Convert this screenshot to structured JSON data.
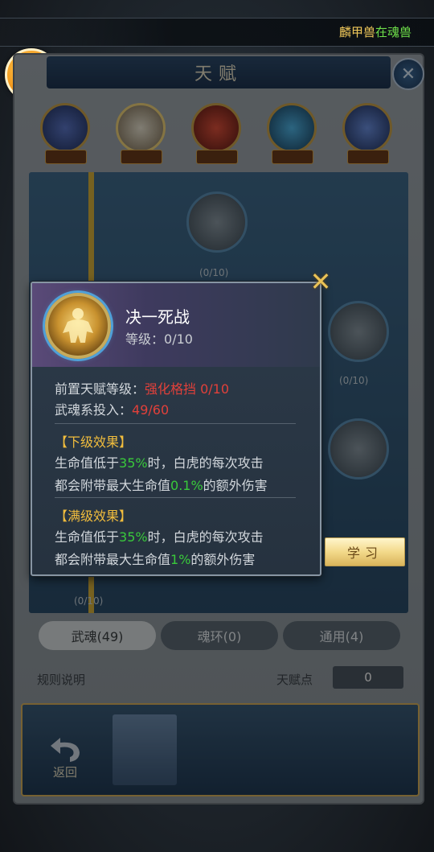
{
  "top_notice": {
    "name": "麟甲兽",
    "message": "在魂兽"
  },
  "panel": {
    "title": "天赋",
    "souls": [
      {
        "tag": "",
        "level": ""
      },
      {
        "tag": "",
        "level": ""
      },
      {
        "tag": "",
        "level": ""
      },
      {
        "tag": "",
        "level": ""
      },
      {
        "tag": "",
        "level": ""
      }
    ],
    "nodes": [
      {
        "label": "",
        "progress": "(0/10)"
      },
      {
        "label": "",
        "progress": "(0/10)"
      },
      {
        "label": "",
        "progress": "(0/10)"
      }
    ],
    "tabs": [
      {
        "label": "武魂(49)"
      },
      {
        "label": "魂环(0)"
      },
      {
        "label": "通用(4)"
      }
    ],
    "rules_label": "规则说明",
    "points_label": "天赋点",
    "points_value": "0",
    "back_label": "返回"
  },
  "tooltip": {
    "skill_name": "决一死战",
    "level_label": "等级：",
    "level_value": "0/10",
    "prereq_label": "前置天赋等级：",
    "prereq_value": "强化格挡 0/10",
    "invest_label": "武魂系投入：",
    "invest_value": "49/60",
    "next_effect_title": "【下级效果】",
    "next_line1": [
      "生命值低于",
      "35%",
      "时，白虎的每次攻击"
    ],
    "next_line2": [
      "都会附带最大生命值",
      "0.1%",
      "的额外伤害"
    ],
    "max_effect_title": "【满级效果】",
    "max_line1": [
      "生命值低于",
      "35%",
      "时，白虎的每次攻击"
    ],
    "max_line2": [
      "都会附带最大生命值",
      "1%",
      "的额外伤害"
    ]
  },
  "learn_button": "学习",
  "colors": {
    "accent_gold": "#f1bd3d",
    "highlight_green": "#39c93b",
    "warning_red": "#e2403a"
  }
}
